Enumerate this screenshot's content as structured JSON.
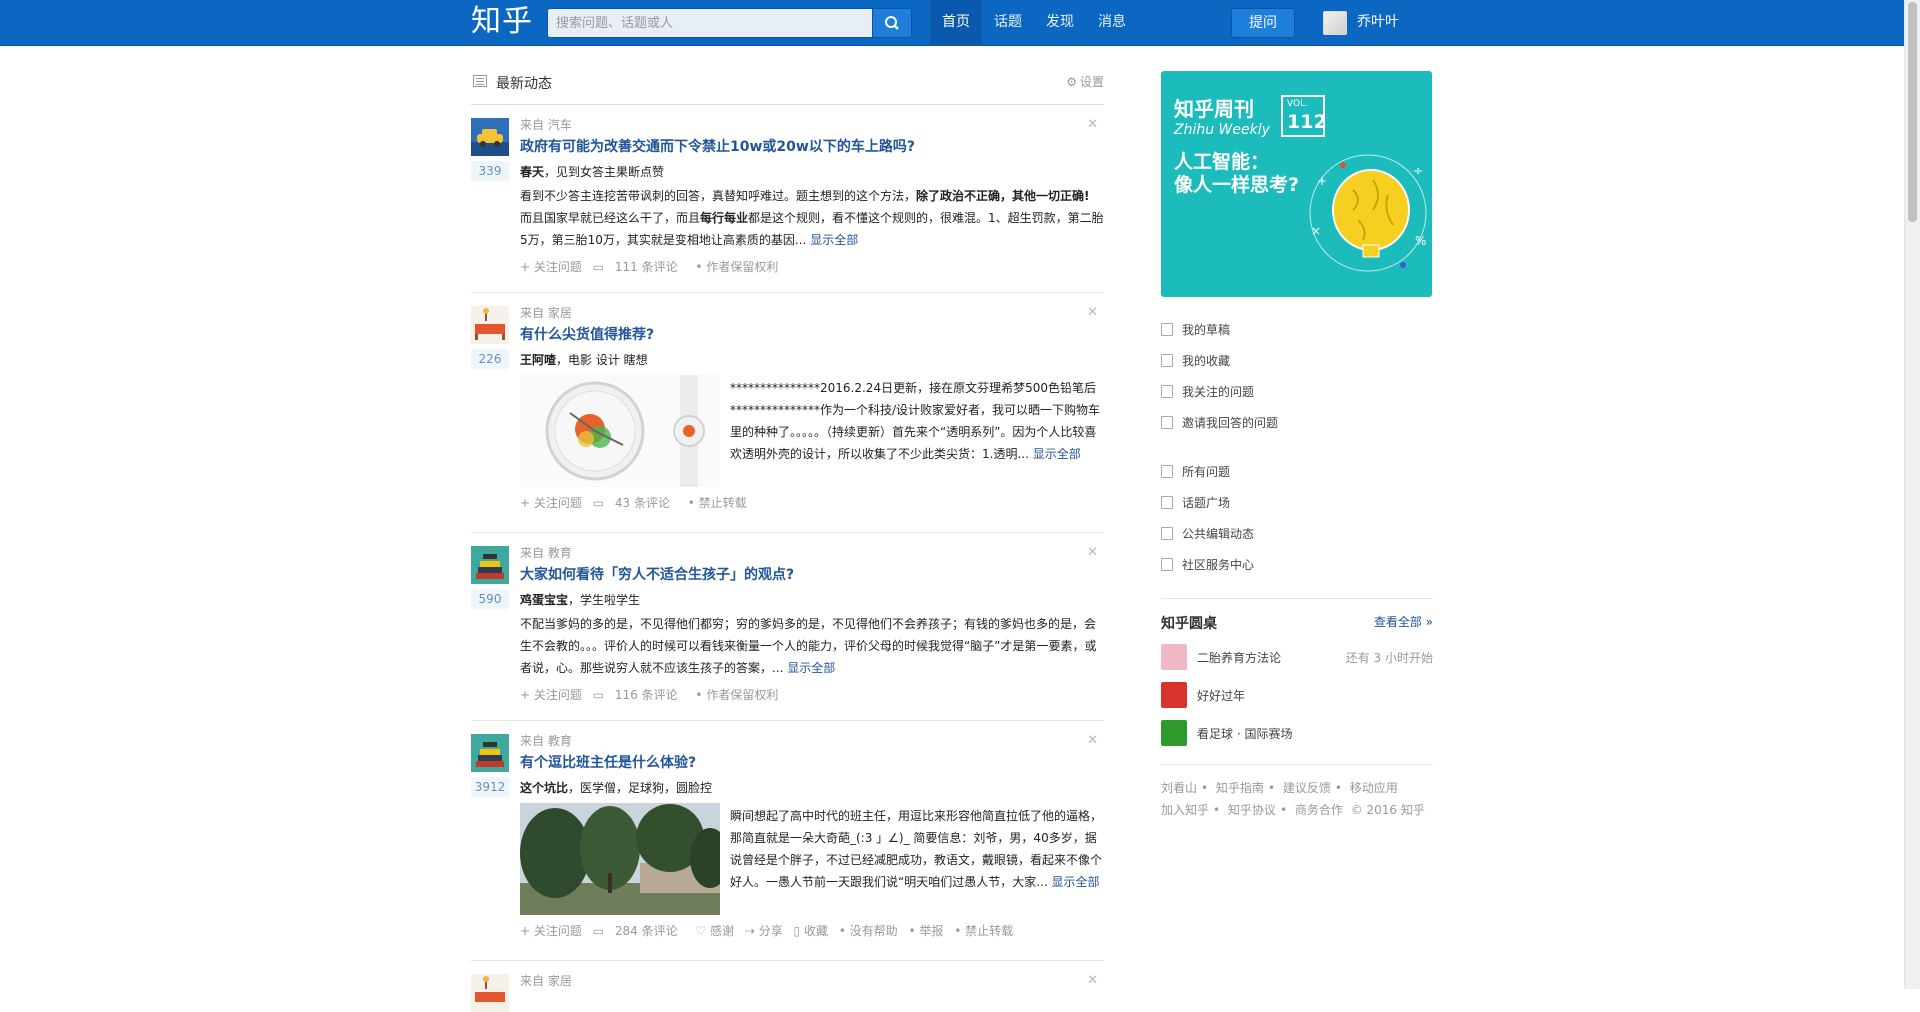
{
  "header": {
    "logo": "知乎",
    "search_placeholder": "搜索问题、话题或人",
    "nav": [
      "首页",
      "话题",
      "发现",
      "消息"
    ],
    "ask_label": "提问",
    "username": "乔叶叶"
  },
  "feed": {
    "title": "最新动态",
    "settings_label": "设置",
    "show_all": "显示全部",
    "items": [
      {
        "source": "来自 汽车",
        "votes": "339",
        "title": "政府有可能为改善交通而下令禁止10w或20w以下的车上路吗?",
        "author_name": "春天",
        "author_bio": "，见到女答主果断点赞",
        "excerpt_a": "看到不少答主连挖苦带讽刺的回答，真替知呼难过。题主想到的这个方法，",
        "excerpt_b": "除了政治不正确，其他一切正确!",
        "excerpt_c": " 而且国家早就已经这么干了，而且",
        "excerpt_d": "每行每业",
        "excerpt_e": "都是这个规则，看不懂这个规则的，很难混。1、超生罚款，第二胎5万，第三胎10万，其实就是变相地让高素质的基因...",
        "actions": [
          "+ 关注问题",
          "111 条评论",
          "• 作者保留权利"
        ]
      },
      {
        "source": "来自 家居",
        "votes": "226",
        "title": "有什么尖货值得推荐?",
        "author_name": "王阿喳",
        "author_bio": "，电影 设计 瞎想",
        "excerpt": "***************2016.2.24日更新，接在原文芬理希梦500色铅笔后***************作为一个科技/设计败家爱好者，我可以晒一下购物车里的种种了。。。。。（持续更新）首先来个“透明系列”。因为个人比较喜欢透明外壳的设计，所以收集了不少此类尖货：1.透明...",
        "actions": [
          "+ 关注问题",
          "43 条评论",
          "• 禁止转载"
        ]
      },
      {
        "source": "来自 教育",
        "votes": "590",
        "title": "大家如何看待「穷人不适合生孩子」的观点?",
        "author_name": "鸡蛋宝宝",
        "author_bio": "，学生啦学生",
        "excerpt": "不配当爹妈的多的是，不见得他们都穷；穷的爹妈多的是，不见得他们不会养孩子；有钱的爹妈也多的是，会生不会教的。。。评价人的时候可以看钱来衡量一个人的能力，评价父母的时候我觉得“脑子”才是第一要素，或者说，心。那些说穷人就不应该生孩子的答案，...",
        "actions": [
          "+ 关注问题",
          "116 条评论",
          "• 作者保留权利"
        ]
      },
      {
        "source": "来自 教育",
        "votes": "3912",
        "title": "有个逗比班主任是什么体验?",
        "author_name": "这个坑比",
        "author_bio": "，医学僧，足球狗，圆脸控",
        "excerpt": "瞬间想起了高中时代的班主任，用逗比来形容他简直拉低了他的逼格，那简直就是一朵大奇葩_(:3 」∠)_ 简要信息：刘爷，男，40多岁，据说曾经是个胖子，不过已经减肥成功，教语文，戴眼镜，看起来不像个好人。一愚人节前一天跟我们说“明天咱们过愚人节，大家...",
        "actions": [
          "+ 关注问题",
          "284 条评论",
          "♡ 感谢",
          "⇢ 分享",
          "▯ 收藏",
          "• 没有帮助",
          "• 举报",
          "• 禁止转载"
        ]
      },
      {
        "source": "来自 家居",
        "votes": "",
        "title": "",
        "actions": []
      }
    ]
  },
  "sidebar": {
    "weekly": {
      "title_cn": "知乎周刊",
      "title_en": "Zhihu Weekly",
      "vol_label": "VOL.",
      "vol_num": "112",
      "line1": "人工智能：",
      "line2": "像人一样思考?"
    },
    "links1": [
      "我的草稿",
      "我的收藏",
      "我关注的问题",
      "邀请我回答的问题"
    ],
    "links2": [
      "所有问题",
      "话题广场",
      "公共编辑动态",
      "社区服务中心"
    ],
    "roundtable": {
      "title": "知乎圆桌",
      "more": "查看全部 »",
      "items": [
        {
          "name": "二胎养育方法论",
          "status": "还有 3 小时开始",
          "color": "#f0b7c6"
        },
        {
          "name": "好好过年",
          "status": "",
          "color": "#d9342b"
        },
        {
          "name": "看足球 · 国际赛场",
          "status": "",
          "color": "#2e9a2e"
        }
      ]
    },
    "footer": {
      "line1": [
        "刘看山",
        "•",
        "知乎指南",
        "•",
        "建议反馈",
        "•",
        "移动应用"
      ],
      "line2": [
        "加入知乎",
        "•",
        "知乎协议",
        "•",
        "商务合作",
        "© 2016 知乎"
      ]
    }
  },
  "colors": {
    "topbar": "#0b67c2",
    "link": "#225599",
    "teal": "#1cbcbc"
  }
}
